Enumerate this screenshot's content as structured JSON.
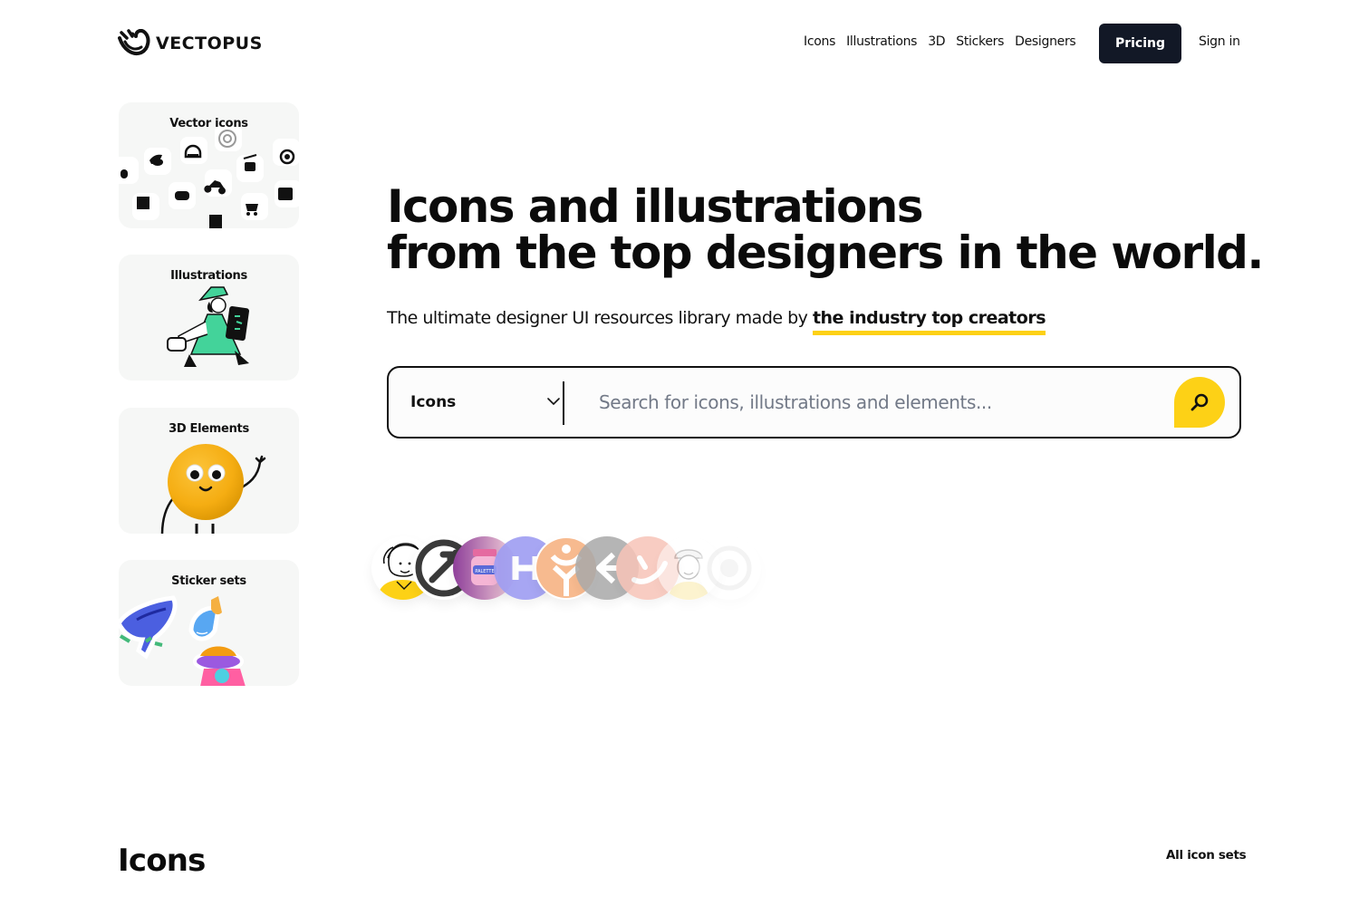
{
  "brand": {
    "name": "VECTOPUS",
    "logo_icon": "octopus-logo-icon"
  },
  "nav": {
    "items": [
      {
        "label": "Icons"
      },
      {
        "label": "Illustrations"
      },
      {
        "label": "3D"
      },
      {
        "label": "Stickers"
      },
      {
        "label": "Designers"
      }
    ],
    "pricing_label": "Pricing",
    "signin_label": "Sign in"
  },
  "categories": [
    {
      "title": "Vector icons",
      "image": "icon-grid-preview"
    },
    {
      "title": "Illustrations",
      "image": "woman-with-tablet-illustration"
    },
    {
      "title": "3D Elements",
      "image": "yellow-ball-character-3d"
    },
    {
      "title": "Sticker sets",
      "image": "whale-and-food-stickers"
    }
  ],
  "hero": {
    "title_line1": "Icons and illustrations",
    "title_line2": "from the top designers in the world.",
    "subtitle_prefix": "The ultimate designer UI resources library made by ",
    "subtitle_highlight": "the industry top creators",
    "highlight_color": "#fdd116"
  },
  "search": {
    "selected_type": "Icons",
    "placeholder": "Search for icons, illustrations and elements...",
    "value": "",
    "button_icon": "search-icon",
    "button_color": "#fdd116"
  },
  "designers": [
    {
      "name": "designer-avatar-1",
      "kind": "illustrated-person-yellow"
    },
    {
      "name": "designer-avatar-2",
      "kind": "dark-wrench-logo"
    },
    {
      "name": "designer-avatar-3",
      "kind": "purple-jar"
    },
    {
      "name": "designer-avatar-4",
      "kind": "purple-h-logo"
    },
    {
      "name": "designer-avatar-5",
      "kind": "orange-y-logo"
    },
    {
      "name": "designer-avatar-6",
      "kind": "gray-k-logo"
    },
    {
      "name": "designer-avatar-7",
      "kind": "salmon-smile-logo"
    },
    {
      "name": "designer-avatar-8",
      "kind": "illustrated-person-hat"
    },
    {
      "name": "designer-avatar-9",
      "kind": "faded-circle-logo"
    }
  ],
  "section": {
    "title": "Icons",
    "link_label": "All icon sets"
  },
  "colors": {
    "primary_dark": "#121826",
    "accent_yellow": "#fdd116",
    "card_bg": "#f6f7f6"
  }
}
